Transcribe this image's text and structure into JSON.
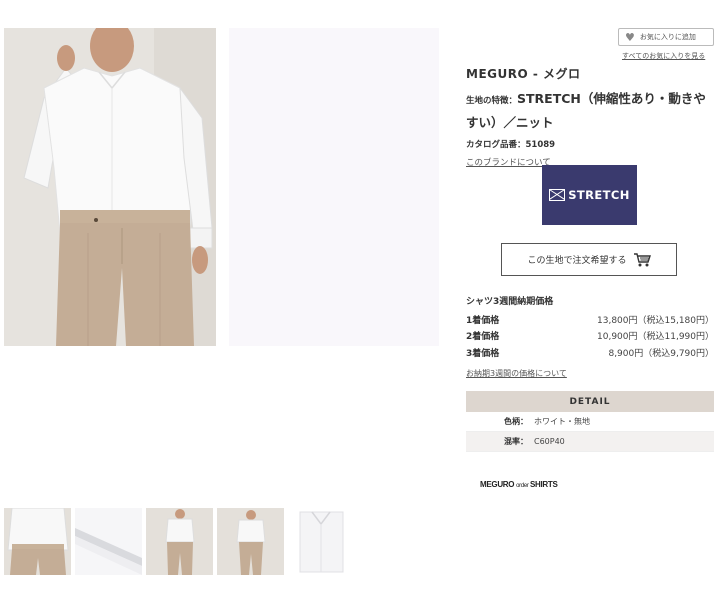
{
  "favorites": {
    "add_label": "お気に入りに追加",
    "list_link": "すべてのお気に入りを見る"
  },
  "product": {
    "brand": "MEGURO - メグロ",
    "feature_label": "生地の特徴：",
    "feature_value": "STRETCH（伸縮性あり・動きやすい）／ニット",
    "catalog_label": "カタログ品番：",
    "catalog_number": "51089",
    "brand_link": "このブランドについて",
    "badge_text": "STRETCH",
    "order_button": "この生地で注文希望する"
  },
  "pricing": {
    "title": "シャツ3週間納期価格",
    "rows": [
      {
        "label": "1着価格",
        "value": "13,800円（税込15,180円）"
      },
      {
        "label": "2着価格",
        "value": "10,900円（税込11,990円）"
      },
      {
        "label": "3着価格",
        "value": "8,900円（税込9,790円）"
      }
    ],
    "link": "お納期3週間の価格について"
  },
  "detail": {
    "heading": "DETAIL",
    "rows": [
      {
        "label": "色柄：",
        "value": "ホワイト・無地"
      },
      {
        "label": "混率：",
        "value": "C60P40"
      }
    ]
  },
  "shop_logo": {
    "part1": "MEGURO ",
    "part2": "order ",
    "part3": "SHIRTS"
  },
  "icons": {
    "favorite": "heart-icon",
    "cart": "cart-icon",
    "stretch": "stretch-mark-icon"
  },
  "colors": {
    "badge_bg": "#3a3a6e",
    "detail_header_bg": "#ddd6cf",
    "fabric": "#f9f7fb"
  }
}
